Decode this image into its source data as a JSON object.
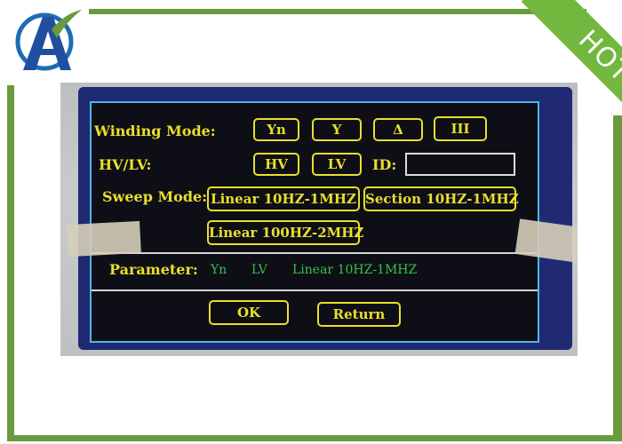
{
  "brand": {
    "logo_icon": "a-logo-icon",
    "badge": "HOT"
  },
  "colors": {
    "frame_green": "#6a9a3e",
    "screen_yellow": "#eadf2d",
    "value_green": "#36c24a",
    "bezel_blue": "#1f2a73"
  },
  "screen": {
    "winding_mode_label": "Winding Mode:",
    "winding_options": [
      "Yn",
      "Y",
      "Δ",
      "III"
    ],
    "hv_lv_label": "HV/LV:",
    "hv_lv_options": [
      "HV",
      "LV"
    ],
    "id_label": "ID:",
    "id_value": "",
    "sweep_mode_label": "Sweep Mode:",
    "sweep_options": [
      "Linear  10HZ-1MHZ",
      "Section 10HZ-1MHZ",
      "Linear 100HZ-2MHZ"
    ],
    "parameter_label": "Parameter:",
    "parameter_values": [
      "Yn",
      "LV",
      "Linear 10HZ-1MHZ"
    ],
    "ok_label": "OK",
    "return_label": "Return"
  }
}
